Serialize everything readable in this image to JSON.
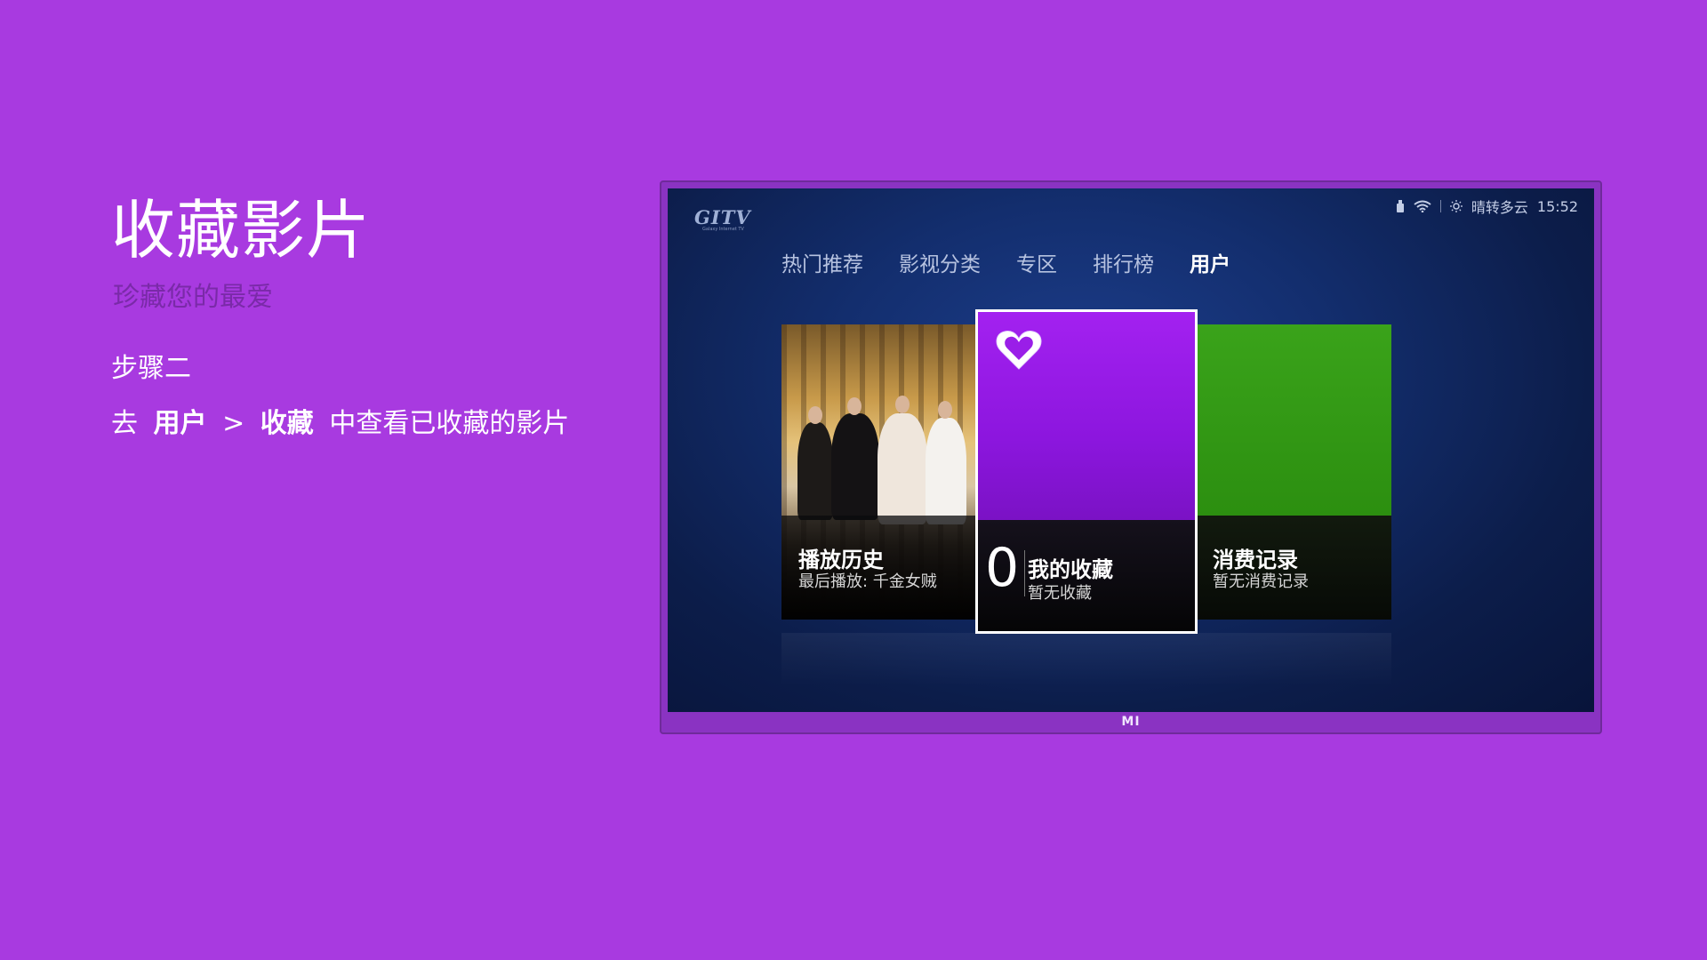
{
  "intro": {
    "title": "收藏影片",
    "subtitle": "珍藏您的最爱",
    "step": "步骤二",
    "desc_prefix": "去",
    "desc_user": "用户",
    "desc_sep": ">",
    "desc_fav": "收藏",
    "desc_suffix": "中查看已收藏的影片"
  },
  "tv": {
    "brand": "GITV",
    "brand_tagline": "Galaxy Internet TV",
    "logo": "MI",
    "status": {
      "weather": "晴转多云",
      "time": "15:52",
      "icons": [
        "usb-icon",
        "wifi-icon",
        "sun-icon"
      ]
    },
    "nav": [
      "热门推荐",
      "影视分类",
      "专区",
      "排行榜",
      "用户"
    ],
    "active_tab": "用户",
    "cards": {
      "history": {
        "title": "播放历史",
        "sub": "最后播放: 千金女贼"
      },
      "favorites": {
        "count": "0",
        "title": "我的收藏",
        "sub": "暂无收藏"
      },
      "purchase": {
        "title": "消费记录",
        "sub": "暂无消费记录"
      }
    }
  },
  "colors": {
    "page_bg": "#a83ae0",
    "fav_purple": "#a321f0",
    "purchase_green": "#3aa31a",
    "screen_blue": "#132e6e"
  }
}
